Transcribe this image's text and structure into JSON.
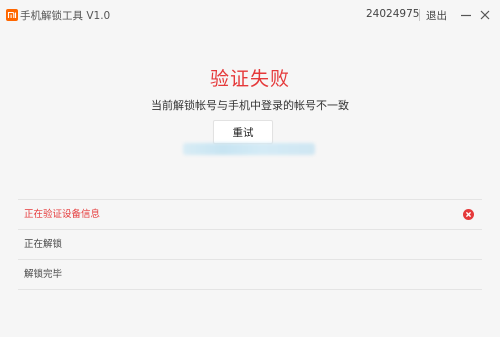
{
  "app": {
    "title": "手机解锁工具 V1.0",
    "account_id": "24024975",
    "logout_label": "退出",
    "logo_icon": "mi-logo-icon",
    "brand_color": "#ff6700"
  },
  "result": {
    "title": "验证失败",
    "description": "当前解锁帐号与手机中登录的帐号不一致",
    "retry_label": "重试",
    "error_color": "#e5393a"
  },
  "steps": [
    {
      "label": "正在验证设备信息",
      "status": "error",
      "icon": "error-x-icon"
    },
    {
      "label": "正在解锁",
      "status": "pending"
    },
    {
      "label": "解锁完毕",
      "status": "pending"
    }
  ]
}
